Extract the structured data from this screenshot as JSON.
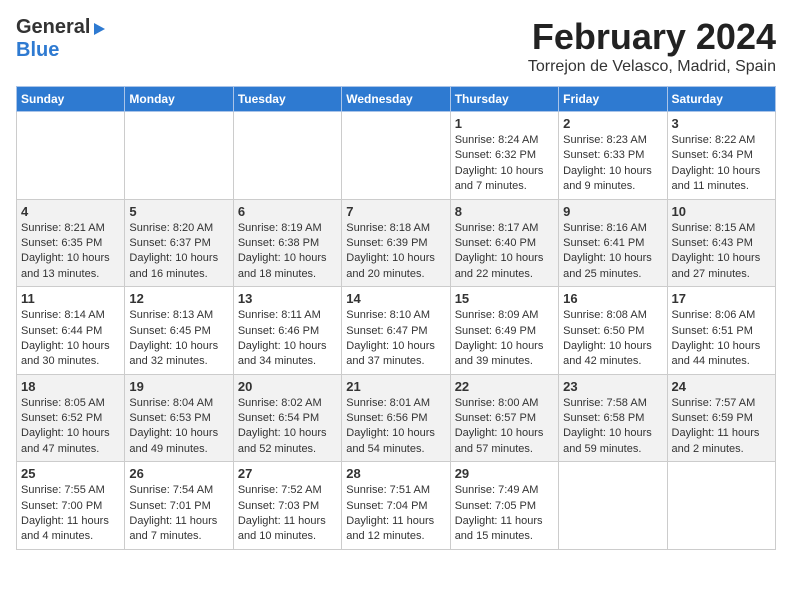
{
  "header": {
    "logo_general": "General",
    "logo_blue": "Blue",
    "title": "February 2024",
    "subtitle": "Torrejon de Velasco, Madrid, Spain"
  },
  "weekdays": [
    "Sunday",
    "Monday",
    "Tuesday",
    "Wednesday",
    "Thursday",
    "Friday",
    "Saturday"
  ],
  "weeks": [
    [
      {
        "day": "",
        "info": ""
      },
      {
        "day": "",
        "info": ""
      },
      {
        "day": "",
        "info": ""
      },
      {
        "day": "",
        "info": ""
      },
      {
        "day": "1",
        "info": "Sunrise: 8:24 AM\nSunset: 6:32 PM\nDaylight: 10 hours\nand 7 minutes."
      },
      {
        "day": "2",
        "info": "Sunrise: 8:23 AM\nSunset: 6:33 PM\nDaylight: 10 hours\nand 9 minutes."
      },
      {
        "day": "3",
        "info": "Sunrise: 8:22 AM\nSunset: 6:34 PM\nDaylight: 10 hours\nand 11 minutes."
      }
    ],
    [
      {
        "day": "4",
        "info": "Sunrise: 8:21 AM\nSunset: 6:35 PM\nDaylight: 10 hours\nand 13 minutes."
      },
      {
        "day": "5",
        "info": "Sunrise: 8:20 AM\nSunset: 6:37 PM\nDaylight: 10 hours\nand 16 minutes."
      },
      {
        "day": "6",
        "info": "Sunrise: 8:19 AM\nSunset: 6:38 PM\nDaylight: 10 hours\nand 18 minutes."
      },
      {
        "day": "7",
        "info": "Sunrise: 8:18 AM\nSunset: 6:39 PM\nDaylight: 10 hours\nand 20 minutes."
      },
      {
        "day": "8",
        "info": "Sunrise: 8:17 AM\nSunset: 6:40 PM\nDaylight: 10 hours\nand 22 minutes."
      },
      {
        "day": "9",
        "info": "Sunrise: 8:16 AM\nSunset: 6:41 PM\nDaylight: 10 hours\nand 25 minutes."
      },
      {
        "day": "10",
        "info": "Sunrise: 8:15 AM\nSunset: 6:43 PM\nDaylight: 10 hours\nand 27 minutes."
      }
    ],
    [
      {
        "day": "11",
        "info": "Sunrise: 8:14 AM\nSunset: 6:44 PM\nDaylight: 10 hours\nand 30 minutes."
      },
      {
        "day": "12",
        "info": "Sunrise: 8:13 AM\nSunset: 6:45 PM\nDaylight: 10 hours\nand 32 minutes."
      },
      {
        "day": "13",
        "info": "Sunrise: 8:11 AM\nSunset: 6:46 PM\nDaylight: 10 hours\nand 34 minutes."
      },
      {
        "day": "14",
        "info": "Sunrise: 8:10 AM\nSunset: 6:47 PM\nDaylight: 10 hours\nand 37 minutes."
      },
      {
        "day": "15",
        "info": "Sunrise: 8:09 AM\nSunset: 6:49 PM\nDaylight: 10 hours\nand 39 minutes."
      },
      {
        "day": "16",
        "info": "Sunrise: 8:08 AM\nSunset: 6:50 PM\nDaylight: 10 hours\nand 42 minutes."
      },
      {
        "day": "17",
        "info": "Sunrise: 8:06 AM\nSunset: 6:51 PM\nDaylight: 10 hours\nand 44 minutes."
      }
    ],
    [
      {
        "day": "18",
        "info": "Sunrise: 8:05 AM\nSunset: 6:52 PM\nDaylight: 10 hours\nand 47 minutes."
      },
      {
        "day": "19",
        "info": "Sunrise: 8:04 AM\nSunset: 6:53 PM\nDaylight: 10 hours\nand 49 minutes."
      },
      {
        "day": "20",
        "info": "Sunrise: 8:02 AM\nSunset: 6:54 PM\nDaylight: 10 hours\nand 52 minutes."
      },
      {
        "day": "21",
        "info": "Sunrise: 8:01 AM\nSunset: 6:56 PM\nDaylight: 10 hours\nand 54 minutes."
      },
      {
        "day": "22",
        "info": "Sunrise: 8:00 AM\nSunset: 6:57 PM\nDaylight: 10 hours\nand 57 minutes."
      },
      {
        "day": "23",
        "info": "Sunrise: 7:58 AM\nSunset: 6:58 PM\nDaylight: 10 hours\nand 59 minutes."
      },
      {
        "day": "24",
        "info": "Sunrise: 7:57 AM\nSunset: 6:59 PM\nDaylight: 11 hours\nand 2 minutes."
      }
    ],
    [
      {
        "day": "25",
        "info": "Sunrise: 7:55 AM\nSunset: 7:00 PM\nDaylight: 11 hours\nand 4 minutes."
      },
      {
        "day": "26",
        "info": "Sunrise: 7:54 AM\nSunset: 7:01 PM\nDaylight: 11 hours\nand 7 minutes."
      },
      {
        "day": "27",
        "info": "Sunrise: 7:52 AM\nSunset: 7:03 PM\nDaylight: 11 hours\nand 10 minutes."
      },
      {
        "day": "28",
        "info": "Sunrise: 7:51 AM\nSunset: 7:04 PM\nDaylight: 11 hours\nand 12 minutes."
      },
      {
        "day": "29",
        "info": "Sunrise: 7:49 AM\nSunset: 7:05 PM\nDaylight: 11 hours\nand 15 minutes."
      },
      {
        "day": "",
        "info": ""
      },
      {
        "day": "",
        "info": ""
      }
    ]
  ]
}
